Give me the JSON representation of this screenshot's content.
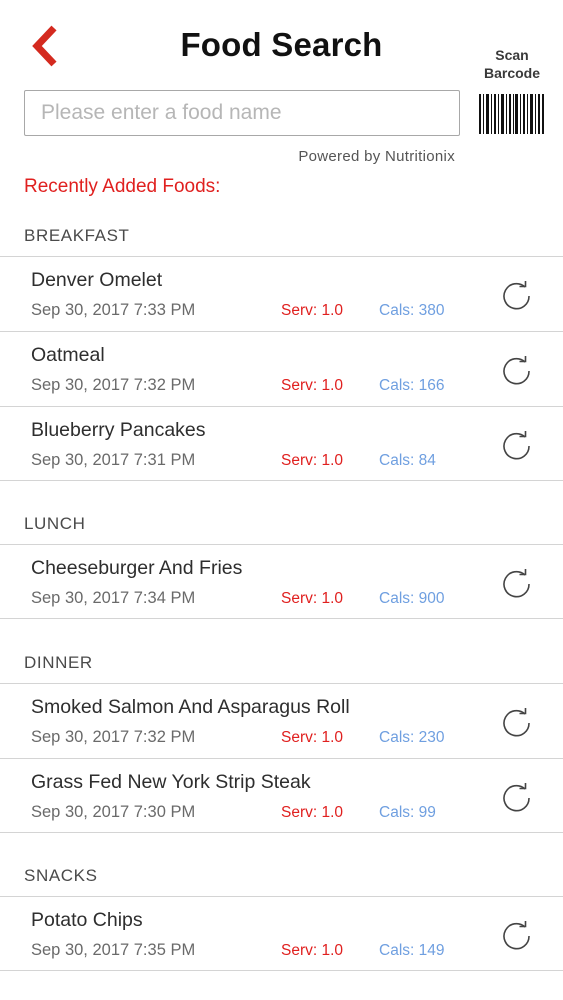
{
  "header": {
    "title": "Food Search",
    "scan_label_line1": "Scan",
    "scan_label_line2": "Barcode"
  },
  "search": {
    "placeholder": "Please enter a food name",
    "value": ""
  },
  "powered_by": "Powered by Nutritionix",
  "recent_heading": "Recently Added Foods:",
  "colors": {
    "accent_red": "#e0201f",
    "calories_blue": "#6f9fe0",
    "divider": "#d4d4d4"
  },
  "icons": {
    "back": "chevron-left-icon",
    "barcode": "barcode-icon",
    "readd": "refresh-icon"
  },
  "sections": [
    {
      "name": "BREAKFAST",
      "items": [
        {
          "name": "Denver Omelet",
          "date": "Sep 30, 2017 7:33 PM",
          "serv": "Serv: 1.0",
          "cals": "Cals: 380"
        },
        {
          "name": "Oatmeal",
          "date": "Sep 30, 2017 7:32 PM",
          "serv": "Serv: 1.0",
          "cals": "Cals: 166"
        },
        {
          "name": "Blueberry Pancakes",
          "date": "Sep 30, 2017 7:31 PM",
          "serv": "Serv: 1.0",
          "cals": "Cals: 84"
        }
      ]
    },
    {
      "name": "LUNCH",
      "items": [
        {
          "name": "Cheeseburger And Fries",
          "date": "Sep 30, 2017 7:34 PM",
          "serv": "Serv: 1.0",
          "cals": "Cals: 900"
        }
      ]
    },
    {
      "name": "DINNER",
      "items": [
        {
          "name": "Smoked Salmon And Asparagus Roll",
          "date": "Sep 30, 2017 7:32 PM",
          "serv": "Serv: 1.0",
          "cals": "Cals: 230"
        },
        {
          "name": "Grass Fed New York Strip Steak",
          "date": "Sep 30, 2017 7:30 PM",
          "serv": "Serv: 1.0",
          "cals": "Cals: 99"
        }
      ]
    },
    {
      "name": "SNACKS",
      "items": [
        {
          "name": "Potato Chips",
          "date": "Sep 30, 2017 7:35 PM",
          "serv": "Serv: 1.0",
          "cals": "Cals: 149"
        }
      ]
    }
  ]
}
